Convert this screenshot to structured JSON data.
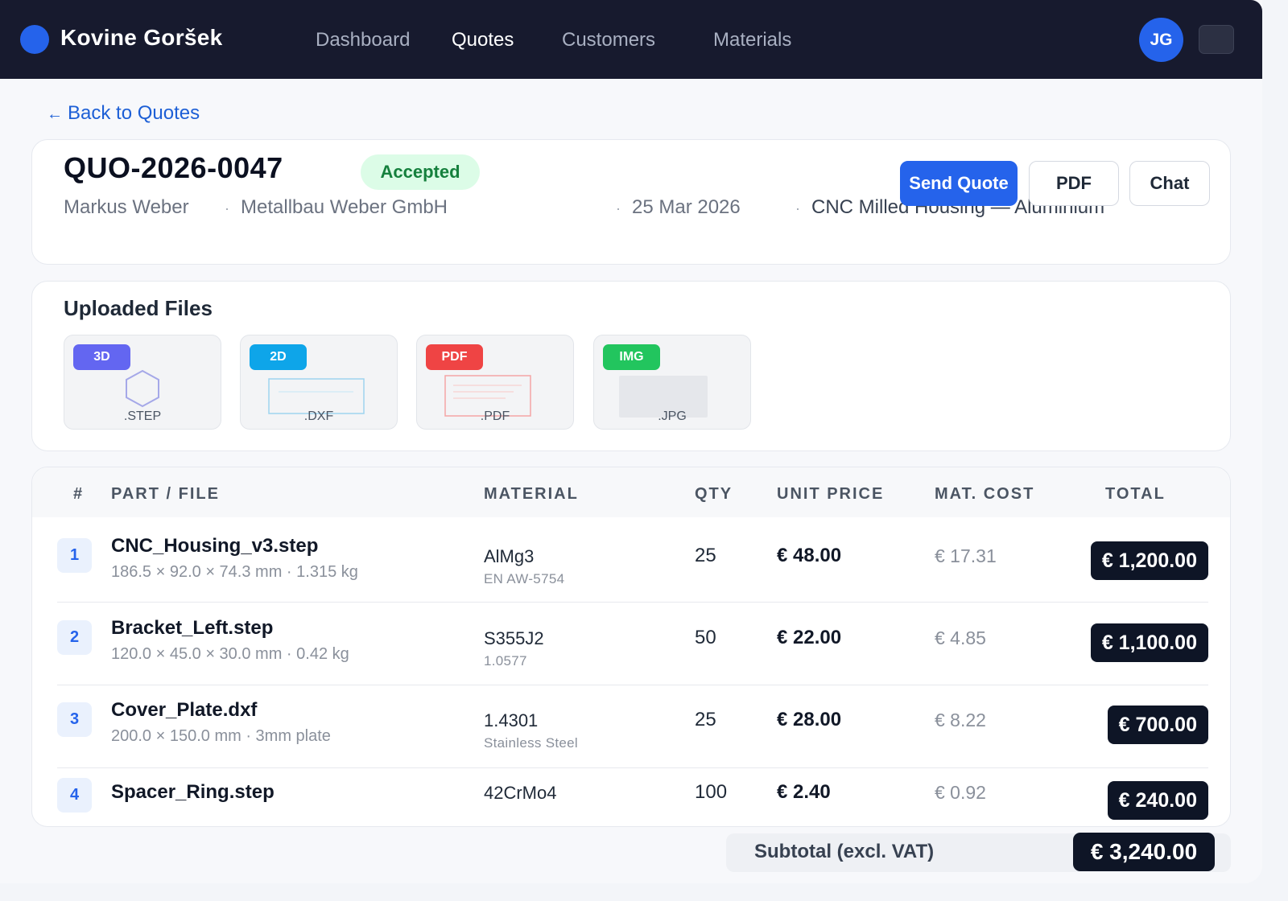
{
  "app": {
    "brand": "Kovine Goršek",
    "nav": [
      "Dashboard",
      "Quotes",
      "Customers",
      "Materials"
    ],
    "active_nav": "Quotes",
    "user_initials": "JG",
    "accent": "#2563eb",
    "nav_bg": "#171a2e"
  },
  "back_link": "Back to Quotes",
  "quote": {
    "number": "QUO-2026-0047",
    "status": "Accepted",
    "status_color": "#15803d",
    "customer": "Markus Weber",
    "company": "Metallbau Weber GmbH",
    "date": "25 Mar 2026",
    "project": "CNC Milled Housing — Aluminium",
    "separator": "·"
  },
  "actions": {
    "send": "Send Quote",
    "pdf": "PDF",
    "chat": "Chat"
  },
  "files": {
    "title": "Uploaded Files",
    "items": [
      {
        "badge": "3D",
        "ext": ".STEP",
        "badge_color": "#6366f1"
      },
      {
        "badge": "2D",
        "ext": ".DXF",
        "badge_color": "#0ea5e9"
      },
      {
        "badge": "PDF",
        "ext": ".PDF",
        "badge_color": "#ef4444"
      },
      {
        "badge": "IMG",
        "ext": ".JPG",
        "badge_color": "#22c55e"
      }
    ]
  },
  "table": {
    "headers": [
      "#",
      "PART / FILE",
      "MATERIAL",
      "QTY",
      "UNIT PRICE",
      "MAT. COST",
      "TOTAL"
    ],
    "rows": [
      {
        "n": "1",
        "name": "CNC_Housing_v3.step",
        "dims": "186.5 × 92.0 × 74.3 mm · 1.315 kg",
        "material": "AlMg3",
        "material_sub": "EN AW-5754",
        "qty": "25",
        "unit": "€ 48.00",
        "mat_cost": "€ 17.31",
        "total": "€ 1,200.00"
      },
      {
        "n": "2",
        "name": "Bracket_Left.step",
        "dims": "120.0 × 45.0 × 30.0 mm · 0.42 kg",
        "material": "S355J2",
        "material_sub": "1.0577",
        "qty": "50",
        "unit": "€ 22.00",
        "mat_cost": "€ 4.85",
        "total": "€ 1,100.00"
      },
      {
        "n": "3",
        "name": "Cover_Plate.dxf",
        "dims": "200.0 × 150.0 mm · 3mm plate",
        "material": "1.4301",
        "material_sub": "Stainless Steel",
        "qty": "25",
        "unit": "€ 28.00",
        "mat_cost": "€ 8.22",
        "total": "€ 700.00"
      },
      {
        "n": "4",
        "name": "Spacer_Ring.step",
        "dims": "",
        "material": "42CrMo4",
        "material_sub": "",
        "qty": "100",
        "unit": "€ 2.40",
        "mat_cost": "€ 0.92",
        "total": "€ 240.00"
      }
    ]
  },
  "subtotal": {
    "label": "Subtotal (excl. VAT)",
    "value": "€ 3,240.00"
  }
}
